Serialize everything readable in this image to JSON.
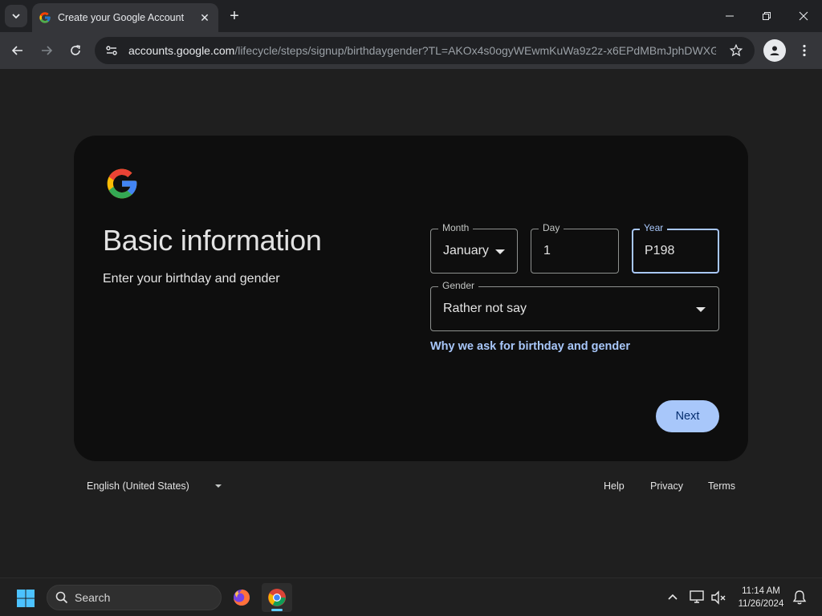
{
  "browser": {
    "tab_title": "Create your Google Account",
    "tab_close": "✕",
    "new_tab": "+",
    "url_host": "accounts.google.com",
    "url_path": "/lifecycle/steps/signup/birthdaygender?TL=AKOx4s0ogyWEwmKuWa9z2z-x6EPdMBmJphDWXG..."
  },
  "page": {
    "heading": "Basic information",
    "subheading": "Enter your birthday and gender",
    "month": {
      "label": "Month",
      "value": "January"
    },
    "day": {
      "label": "Day",
      "value": "1"
    },
    "year": {
      "label": "Year",
      "value": "P198"
    },
    "gender": {
      "label": "Gender",
      "value": "Rather not say"
    },
    "why_link": "Why we ask for birthday and gender",
    "next_button": "Next"
  },
  "footer": {
    "language": "English (United States)",
    "help": "Help",
    "privacy": "Privacy",
    "terms": "Terms"
  },
  "taskbar": {
    "search_label": "Search",
    "time": "11:14 AM",
    "date": "11/26/2024"
  },
  "colors": {
    "accent": "#a8c7fa",
    "card_bg": "#0e0e0e",
    "page_bg": "#1f1f1f"
  }
}
